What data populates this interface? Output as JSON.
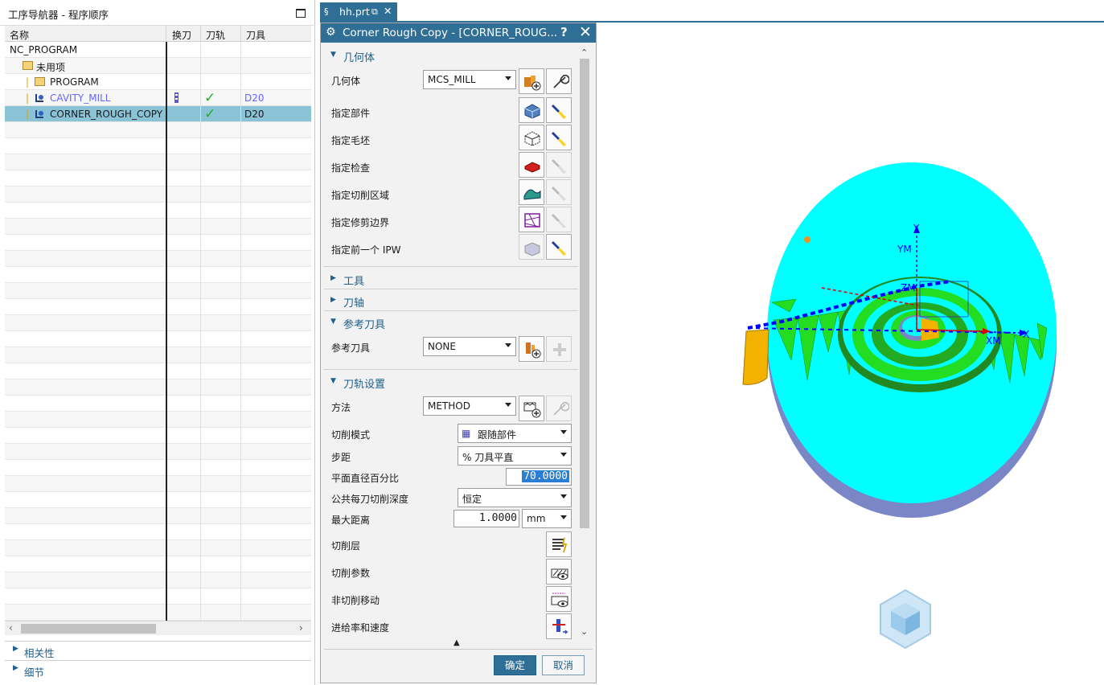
{
  "navigator": {
    "title": "工序导航器 - 程序顺序",
    "columns": [
      "名称",
      "换刀",
      "刀轨",
      "刀具"
    ],
    "rows": [
      {
        "name": "NC_PROGRAM",
        "tool": ""
      },
      {
        "name": "未用项",
        "tool": ""
      },
      {
        "name": "PROGRAM",
        "tool": ""
      },
      {
        "name": "CAVITY_MILL",
        "tool": "D20",
        "toolpath": "✓"
      },
      {
        "name": "CORNER_ROUGH_COPY",
        "tool": "D20",
        "toolpath": "✓",
        "selected": true
      }
    ],
    "bottom_sections": [
      "相关性",
      "细节"
    ]
  },
  "tab": {
    "label": "hh.prt"
  },
  "dialog": {
    "title": "Corner Rough Copy - [CORNER_ROUG...",
    "help": "?",
    "close": "✕",
    "geometry": {
      "header": "几何体",
      "geometry_label": "几何体",
      "geometry_value": "MCS_MILL",
      "specify_part": "指定部件",
      "specify_blank": "指定毛坯",
      "specify_check": "指定检查",
      "specify_cut_area": "指定切削区域",
      "specify_trim": "指定修剪边界",
      "specify_ipw": "指定前一个 IPW"
    },
    "tool_header": "工具",
    "axis_header": "刀轴",
    "ref_tool": {
      "header": "参考刀具",
      "label": "参考刀具",
      "value": "NONE"
    },
    "path_settings": {
      "header": "刀轨设置",
      "method_label": "方法",
      "method_value": "METHOD",
      "cut_pattern_label": "切削模式",
      "cut_pattern_value": "跟随部件",
      "stepover_label": "步距",
      "stepover_value": "% 刀具平直",
      "percent_label": "平面直径百分比",
      "percent_value": "70.0000",
      "depth_label": "公共每刀切削深度",
      "depth_value": "恒定",
      "max_dist_label": "最大距离",
      "max_dist_value": "1.0000",
      "unit_value": "mm",
      "cut_levels": "切削层",
      "cut_params": "切削参数",
      "non_cutting": "非切削移动",
      "feeds": "进给率和速度"
    },
    "ok": "确定",
    "cancel": "取消"
  },
  "viewport": {
    "axis_labels": {
      "y": "Y",
      "ym": "YM",
      "zm": "ZM",
      "x": "X",
      "xm": "XM"
    }
  },
  "colors": {
    "accent": "#2f6f95",
    "part": "#00ffff",
    "path_green": "#22dd22",
    "path_blue": "#0000ff"
  }
}
